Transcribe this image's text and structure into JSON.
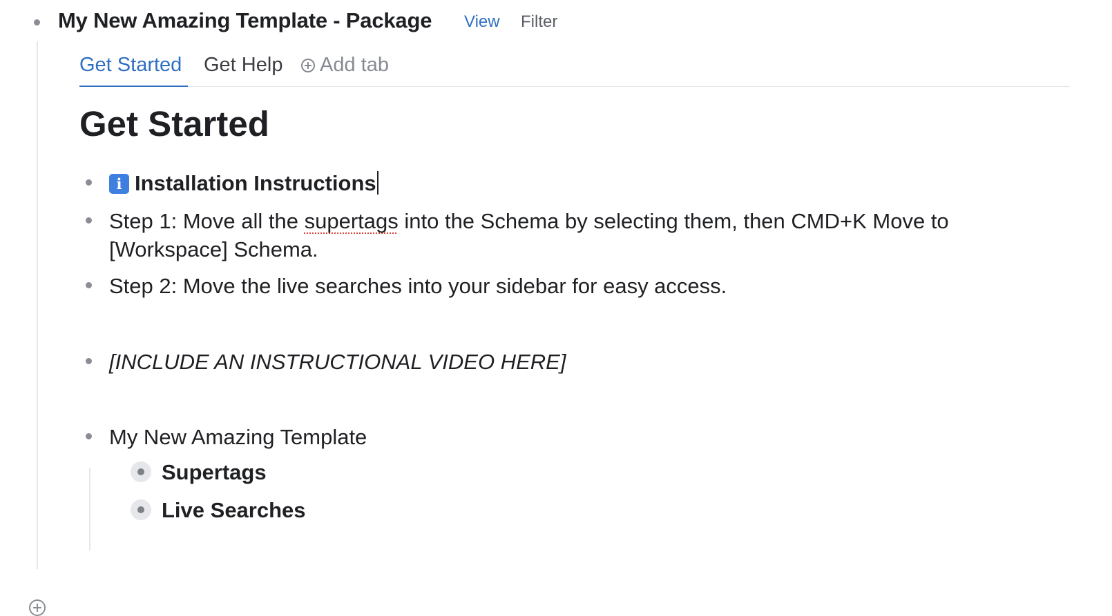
{
  "node": {
    "title": "My New Amazing Template - Package",
    "view_label": "View",
    "filter_label": "Filter"
  },
  "tabs": [
    {
      "label": "Get Started",
      "active": true
    },
    {
      "label": "Get Help",
      "active": false
    }
  ],
  "add_tab_label": "Add tab",
  "heading": "Get Started",
  "items": [
    {
      "icon": "info-icon",
      "icon_glyph": "i",
      "text": "Installation Instructions"
    },
    {
      "pre": "Step 1: Move all the ",
      "flagged": "supertags",
      "post": " into the Schema by selecting them, then CMD+K Move to",
      "line2": "[Workspace] Schema."
    },
    {
      "text": "Step 2: Move the live searches into your sidebar for easy access."
    },
    {
      "text": "[INCLUDE AN INSTRUCTIONAL VIDEO HERE]"
    },
    {
      "text": "My New Amazing Template"
    }
  ],
  "children": [
    {
      "text": "Supertags"
    },
    {
      "text": "Live Searches"
    }
  ],
  "colors": {
    "accent": "#2f6fc1",
    "info_icon": "#3f7fe0",
    "spellcheck": "#e0443a"
  }
}
